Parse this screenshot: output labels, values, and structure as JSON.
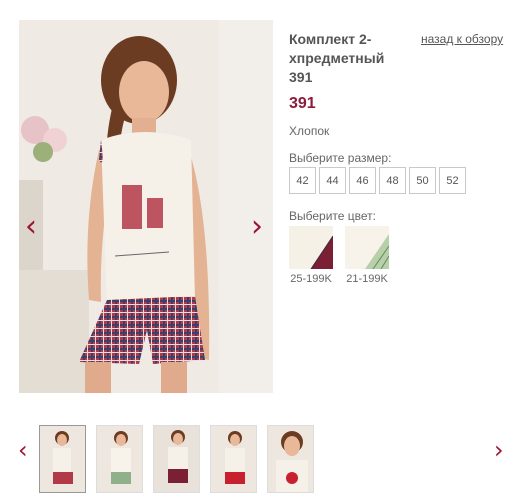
{
  "product": {
    "title": "Комплект 2-хпредметный 391",
    "price": "391",
    "material": "Хлопок"
  },
  "nav": {
    "back_link": "назад к обзору",
    "prev_arrow": "‹",
    "next_arrow": "›"
  },
  "sizes": {
    "label": "Выберите размер:",
    "options": [
      "42",
      "44",
      "46",
      "48",
      "50",
      "52"
    ]
  },
  "colors": {
    "label": "Выберите цвет:",
    "options": [
      {
        "caption": "25-199K",
        "accent": "#7a1f34"
      },
      {
        "caption": "21-199K",
        "accent": "#5f8f5a"
      }
    ]
  },
  "palette": {
    "accent": "#9a1535",
    "price": "#8b1c3b"
  },
  "thumbnails": {
    "count": 5,
    "selected_index": 0
  }
}
